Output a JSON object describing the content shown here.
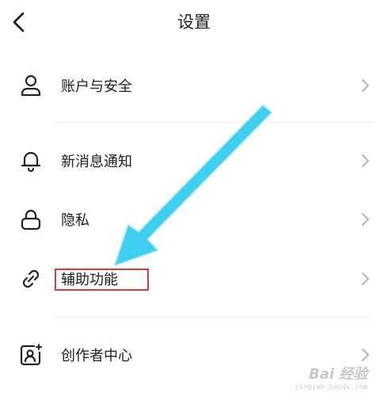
{
  "header": {
    "title": "设置",
    "back_icon": "chevron-left-icon"
  },
  "items": [
    {
      "label": "账户与安全",
      "icon": "user-icon"
    },
    {
      "label": "新消息通知",
      "icon": "bell-icon"
    },
    {
      "label": "隐私",
      "icon": "lock-icon"
    },
    {
      "label": "辅助功能",
      "icon": "link-icon"
    },
    {
      "label": "创作者中心",
      "icon": "creator-badge-icon"
    }
  ],
  "annotation": {
    "arrow_color": "#3fcfef",
    "box_color": "#e0393a"
  },
  "watermark": {
    "text": "Bai 经验",
    "sub": "jingyan.baidu.com"
  }
}
